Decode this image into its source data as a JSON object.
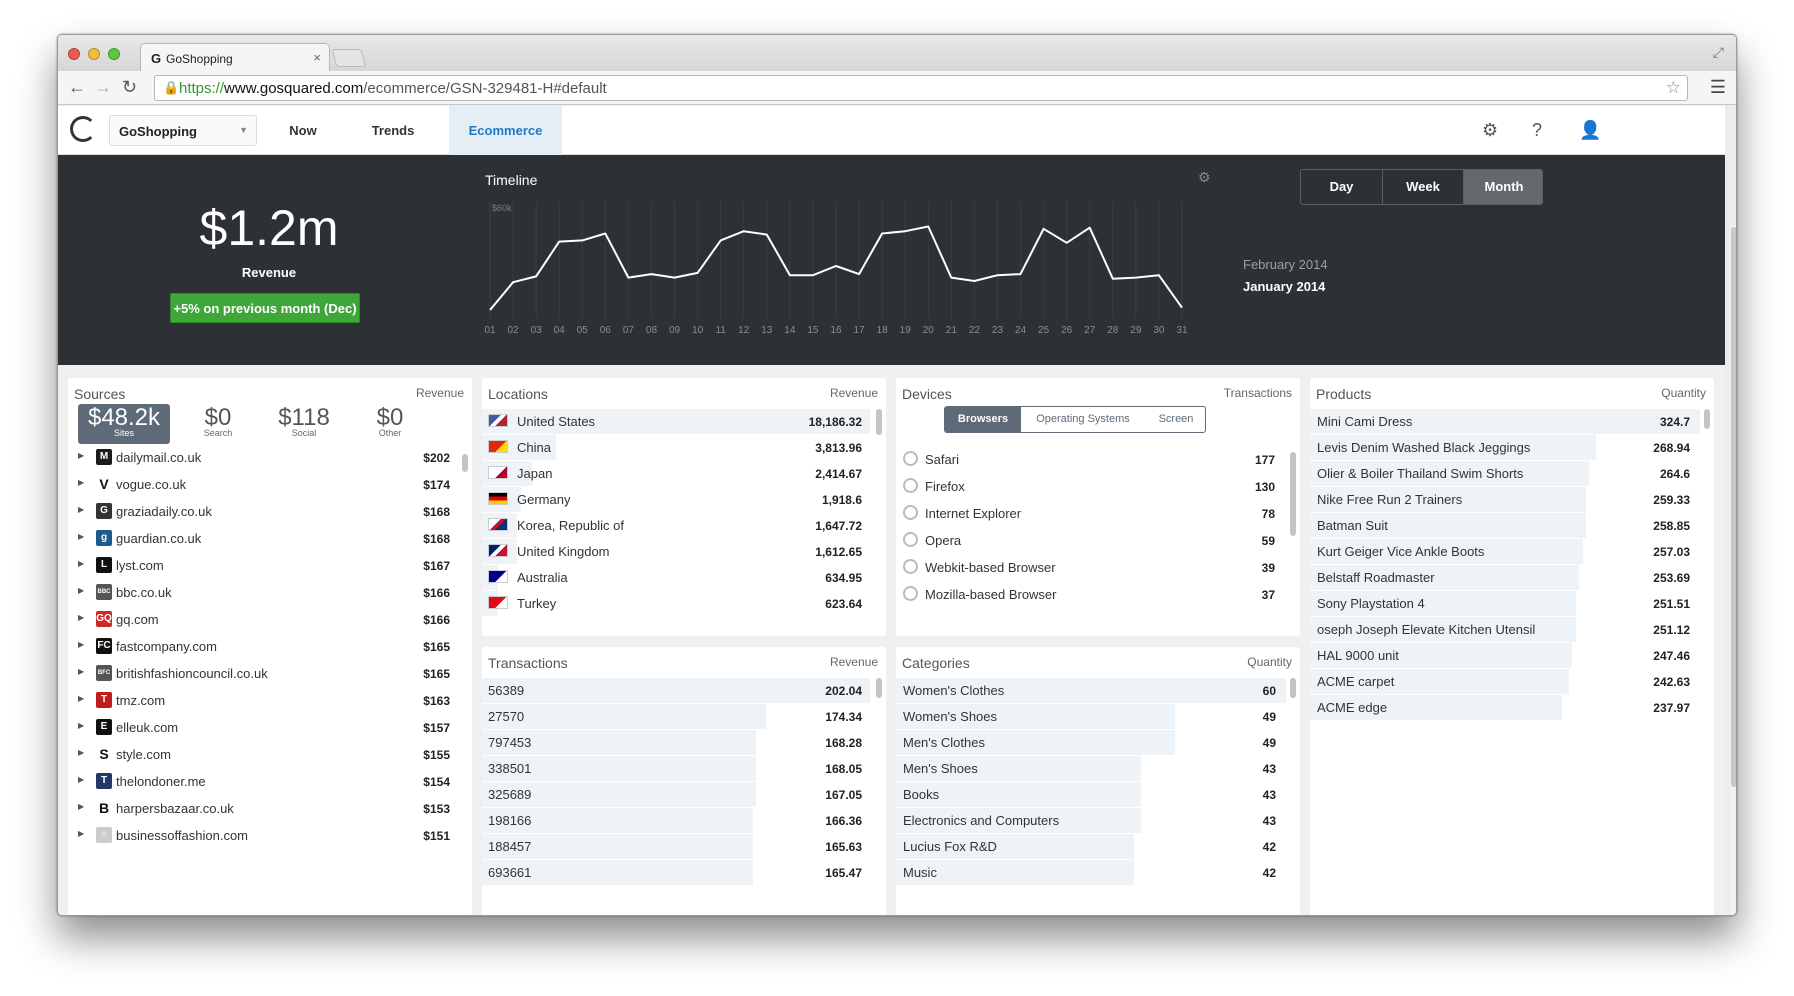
{
  "browser": {
    "tab_title": "GoShopping",
    "url_scheme": "https://",
    "url_host": "www.gosquared.com",
    "url_path": "/ecommerce/GSN-329481-H#default"
  },
  "nav": {
    "site": "GoShopping",
    "items": [
      "Now",
      "Trends",
      "Ecommerce"
    ],
    "active": "Ecommerce"
  },
  "hero": {
    "revenue_value": "$1.2m",
    "revenue_label": "Revenue",
    "badge": "+5% on previous month (Dec)",
    "timeline_title": "Timeline",
    "periods": [
      "Day",
      "Week",
      "Month"
    ],
    "active_period": "Month",
    "legend_prev": "February 2014",
    "legend_curr": "January 2014"
  },
  "chart_data": {
    "type": "line",
    "title": "Timeline",
    "x": [
      "01",
      "02",
      "03",
      "04",
      "05",
      "06",
      "07",
      "08",
      "09",
      "10",
      "11",
      "12",
      "13",
      "14",
      "15",
      "16",
      "17",
      "18",
      "19",
      "20",
      "21",
      "22",
      "23",
      "24",
      "25",
      "26",
      "27",
      "28",
      "29",
      "30",
      "31"
    ],
    "ytick": "$60k",
    "series": [
      {
        "values": [
          6,
          30,
          35,
          65,
          66,
          72,
          34,
          37,
          34,
          38,
          66,
          74,
          71,
          36,
          36,
          44,
          37,
          72,
          74,
          78,
          34,
          31,
          36,
          37,
          76,
          64,
          77,
          33,
          34,
          36,
          8
        ]
      }
    ],
    "ylim": [
      0,
      100
    ],
    "grid": true
  },
  "sources": {
    "title": "Sources",
    "metric": "Revenue",
    "stats": [
      {
        "value": "$48.2k",
        "label": "Sites"
      },
      {
        "value": "$0",
        "label": "Search"
      },
      {
        "value": "$118",
        "label": "Social"
      },
      {
        "value": "$0",
        "label": "Other"
      }
    ],
    "rows": [
      {
        "name": "dailymail.co.uk",
        "value": "$202",
        "icon": "M",
        "color": "#1b1b1b"
      },
      {
        "name": "vogue.co.uk",
        "value": "$174",
        "icon": "V",
        "color": "#ffffff"
      },
      {
        "name": "graziadaily.co.uk",
        "value": "$168",
        "icon": "G",
        "color": "#333333"
      },
      {
        "name": "guardian.co.uk",
        "value": "$168",
        "icon": "g",
        "color": "#1d5a8c"
      },
      {
        "name": "lyst.com",
        "value": "$167",
        "icon": "L",
        "color": "#111111"
      },
      {
        "name": "bbc.co.uk",
        "value": "$166",
        "icon": "BBC",
        "color": "#555555"
      },
      {
        "name": "gq.com",
        "value": "$166",
        "icon": "GQ",
        "color": "#c92a2a"
      },
      {
        "name": "fastcompany.com",
        "value": "$165",
        "icon": "FC",
        "color": "#111111"
      },
      {
        "name": "britishfashioncouncil.co.uk",
        "value": "$165",
        "icon": "BFC",
        "color": "#555555"
      },
      {
        "name": "tmz.com",
        "value": "$163",
        "icon": "T",
        "color": "#c21b1b"
      },
      {
        "name": "elleuk.com",
        "value": "$157",
        "icon": "E",
        "color": "#111111"
      },
      {
        "name": "style.com",
        "value": "$155",
        "icon": "S",
        "color": "#ffffff"
      },
      {
        "name": "thelondoner.me",
        "value": "$154",
        "icon": "T",
        "color": "#233a66"
      },
      {
        "name": "harpersbazaar.co.uk",
        "value": "$153",
        "icon": "B",
        "color": "#ffffff"
      },
      {
        "name": "businessoffashion.com",
        "value": "$151",
        "icon": "○",
        "color": "#cccccc"
      }
    ]
  },
  "locations": {
    "title": "Locations",
    "metric": "Revenue",
    "rows": [
      {
        "name": "United States",
        "value": "18,186.32",
        "share": 1.0
      },
      {
        "name": "China",
        "value": "3,813.96",
        "share": 0.19
      },
      {
        "name": "Japan",
        "value": "2,414.67",
        "share": 0.13
      },
      {
        "name": "Germany",
        "value": "1,918.6",
        "share": 0.1
      },
      {
        "name": "Korea, Republic of",
        "value": "1,647.72",
        "share": 0.09
      },
      {
        "name": "United Kingdom",
        "value": "1,612.65",
        "share": 0.09
      },
      {
        "name": "Australia",
        "value": "634.95",
        "share": 0.04
      },
      {
        "name": "Turkey",
        "value": "623.64",
        "share": 0.04
      }
    ]
  },
  "devices": {
    "title": "Devices",
    "metric": "Transactions",
    "tabs": [
      "Browsers",
      "Operating Systems",
      "Screen Sizes"
    ],
    "active_tab": "Browsers",
    "rows": [
      {
        "name": "Safari",
        "value": "177"
      },
      {
        "name": "Firefox",
        "value": "130"
      },
      {
        "name": "Internet Explorer",
        "value": "78"
      },
      {
        "name": "Opera",
        "value": "59"
      },
      {
        "name": "Webkit-based Browser",
        "value": "39"
      },
      {
        "name": "Mozilla-based Browser",
        "value": "37"
      }
    ]
  },
  "products": {
    "title": "Products",
    "metric": "Quantity",
    "rows": [
      {
        "name": "Mini Cami Dress",
        "value": "324.7",
        "share": 1.0
      },
      {
        "name": "Levis Denim Washed Black Jeggings",
        "value": "268.94",
        "share": 0.83
      },
      {
        "name": "Olier & Boiler Thailand Swim Shorts",
        "value": "264.6",
        "share": 0.81
      },
      {
        "name": "Nike Free Run 2 Trainers",
        "value": "259.33",
        "share": 0.8
      },
      {
        "name": "Batman Suit",
        "value": "258.85",
        "share": 0.8
      },
      {
        "name": "Kurt Geiger Vice Ankle Boots",
        "value": "257.03",
        "share": 0.79
      },
      {
        "name": "Belstaff Roadmaster",
        "value": "253.69",
        "share": 0.78
      },
      {
        "name": "Sony Playstation 4",
        "value": "251.51",
        "share": 0.77
      },
      {
        "name": "oseph Joseph Elevate Kitchen Utensil",
        "value": "251.12",
        "share": 0.77
      },
      {
        "name": "HAL 9000 unit",
        "value": "247.46",
        "share": 0.76
      },
      {
        "name": "ACME carpet",
        "value": "242.63",
        "share": 0.75
      },
      {
        "name": "ACME edge",
        "value": "237.97",
        "share": 0.73
      }
    ]
  },
  "transactions": {
    "title": "Transactions",
    "metric": "Revenue",
    "rows": [
      {
        "name": "56389",
        "value": "202.04",
        "share": 1.0
      },
      {
        "name": "27570",
        "value": "174.34",
        "share": 0.86
      },
      {
        "name": "797453",
        "value": "168.28",
        "share": 0.83
      },
      {
        "name": "338501",
        "value": "168.05",
        "share": 0.83
      },
      {
        "name": "325689",
        "value": "167.05",
        "share": 0.83
      },
      {
        "name": "198166",
        "value": "166.36",
        "share": 0.82
      },
      {
        "name": "188457",
        "value": "165.63",
        "share": 0.82
      },
      {
        "name": "693661",
        "value": "165.47",
        "share": 0.82
      }
    ]
  },
  "categories": {
    "title": "Categories",
    "metric": "Quantity",
    "rows": [
      {
        "name": "Women's Clothes",
        "value": "60",
        "share": 1.0
      },
      {
        "name": "Women's Shoes",
        "value": "49",
        "share": 0.82
      },
      {
        "name": "Men's Clothes",
        "value": "49",
        "share": 0.82
      },
      {
        "name": "Men's Shoes",
        "value": "43",
        "share": 0.72
      },
      {
        "name": "Books",
        "value": "43",
        "share": 0.72
      },
      {
        "name": "Electronics and Computers",
        "value": "43",
        "share": 0.72
      },
      {
        "name": "Lucius Fox R&D",
        "value": "42",
        "share": 0.7
      },
      {
        "name": "Music",
        "value": "42",
        "share": 0.7
      }
    ]
  }
}
